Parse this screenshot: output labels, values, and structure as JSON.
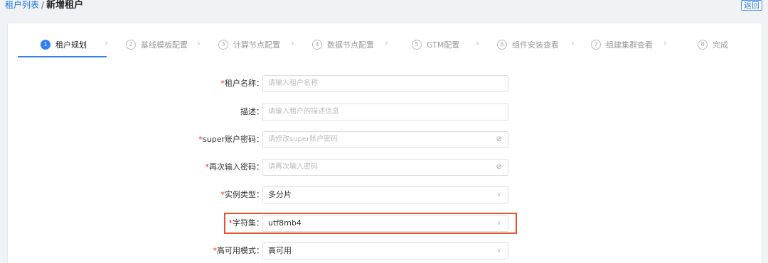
{
  "breadcrumb": {
    "parent": "租户列表",
    "separator": "/",
    "current": "新增租户"
  },
  "header": {
    "back_label": "返回"
  },
  "steps": [
    {
      "num": "1",
      "label": "租户规划"
    },
    {
      "num": "2",
      "label": "基线模板配置"
    },
    {
      "num": "3",
      "label": "计算节点配置"
    },
    {
      "num": "4",
      "label": "数据节点配置"
    },
    {
      "num": "5",
      "label": "GTM配置"
    },
    {
      "num": "6",
      "label": "组件安装查看"
    },
    {
      "num": "7",
      "label": "组建集群查看"
    },
    {
      "num": "8",
      "label": "完成"
    }
  ],
  "active_step": 1,
  "form": {
    "tenant_name": {
      "label": "租户名称：",
      "placeholder": "请输入租户名称"
    },
    "description": {
      "label": "描述：",
      "placeholder": "请输入租户的描述信息"
    },
    "super_password": {
      "label": "super账户密码：",
      "placeholder": "请修改super账户密码"
    },
    "confirm_password": {
      "label": "再次输入密码：",
      "placeholder": "请再次输入密码"
    },
    "instance_type": {
      "label": "实例类型：",
      "value": "多分片"
    },
    "charset": {
      "label": "字符集：",
      "value": "utf8mb4"
    },
    "ha_mode": {
      "label": "高可用模式：",
      "value": "高可用"
    }
  },
  "required_mark": "*",
  "colors": {
    "accent": "#2f7ff5",
    "highlight": "#e2532b",
    "required": "#f5222d"
  }
}
